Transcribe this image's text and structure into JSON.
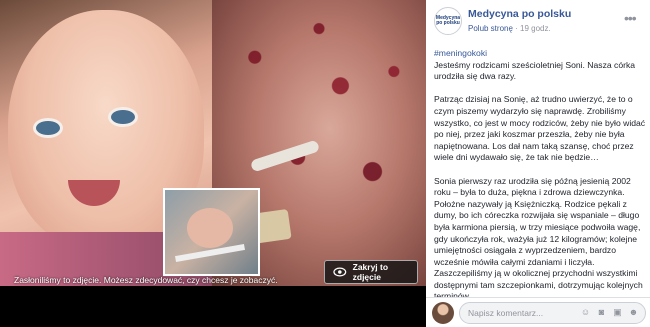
{
  "photo": {
    "caption": "Zasłoniliśmy to zdjęcie. Możesz zdecydować, czy chcesz je zobaczyć.",
    "hide_button_label": "Zakryj to zdjęcie"
  },
  "post": {
    "page_name": "Medycyna po polsku",
    "like_label": "Polub stronę",
    "separator": " · ",
    "time": "19 godz.",
    "avatar_text": "Medycyna po polsku",
    "hashtag": "#meningokoki",
    "paragraphs": [
      "Jesteśmy rodzicami sześcioletniej Soni. Nasza córka urodziła się dwa razy.",
      "Patrząc dzisiaj na Sonię, aż trudno uwierzyć, że to o czym piszemy wydarzyło się naprawdę. Zrobiliśmy wszystko, co jest w mocy rodziców, żeby nie było widać po niej, przez jaki koszmar przeszła, żeby nie była napiętnowana. Los dał nam taką szansę, choć przez wiele dni wydawało się, że tak nie będzie…",
      "Sonia pierwszy raz urodziła się późną jesienią 2002 roku – była to duża, piękna i zdrowa dziewczynka. Położne nazywały ją Księżniczką. Rodzice pękali z dumy, bo ich córeczka rozwijała się wspaniale – długo była karmiona piersią, w trzy miesiące podwoiła wagę, gdy ukończyła rok, ważyła już 12 kilogramów; kolejne umiejętności osiągała z wyprzedzeniem, bardzo wcześnie mówiła całymi zdaniami i liczyła. Zaszczepiliśmy ją w okolicznej przychodni wszystkimi dostępnymi tam szczepionkami, dotrzymując kolejnych terminów"
    ]
  },
  "comment": {
    "placeholder": "Napisz komentarz..."
  },
  "icons": [
    "eye-icon",
    "more-options-icon",
    "camera-icon",
    "gif-icon",
    "sticker-icon",
    "emoji-icon"
  ]
}
